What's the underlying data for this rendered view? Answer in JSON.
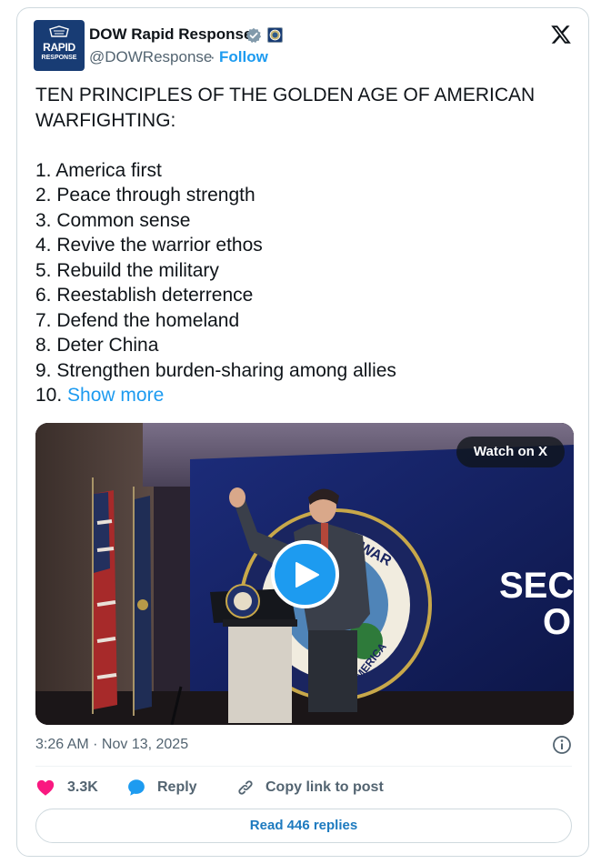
{
  "author": {
    "name": "DOW Rapid Response",
    "handle": "@DOWResponse",
    "separator": "·",
    "follow_label": "Follow",
    "avatar_text_line1": "RAPID",
    "avatar_text_line2": "RESPONSE"
  },
  "tweet": {
    "heading": "TEN PRINCIPLES OF THE GOLDEN AGE OF AMERICAN WARFIGHTING:",
    "items": [
      "1. America first",
      "2. Peace through strength",
      "3. Common sense",
      "4. Revive the warrior ethos",
      "5. Rebuild the military",
      "6. Reestablish deterrence",
      "7. Defend the homeland",
      "8. Deter China",
      "9. Strengthen burden-sharing among allies"
    ],
    "last_item_prefix": "10.",
    "show_more_label": "Show more"
  },
  "media": {
    "watch_label": "Watch on X",
    "screen_text_line1": "SEC",
    "screen_text_line2": "O"
  },
  "timestamp": "3:26 AM · Nov 13, 2025",
  "actions": {
    "likes": "3.3K",
    "reply_label": "Reply",
    "copy_label": "Copy link to post"
  },
  "read_replies_label": "Read 446 replies",
  "colors": {
    "accent": "#1d9bf0",
    "like": "#f91880",
    "text": "#0f1419",
    "muted": "#536471",
    "avatar_bg": "#183c74"
  },
  "icons": [
    "verified-badge-icon",
    "affiliate-seal-icon",
    "x-logo-icon",
    "play-icon",
    "info-icon",
    "heart-icon",
    "reply-bubble-icon",
    "link-icon"
  ]
}
